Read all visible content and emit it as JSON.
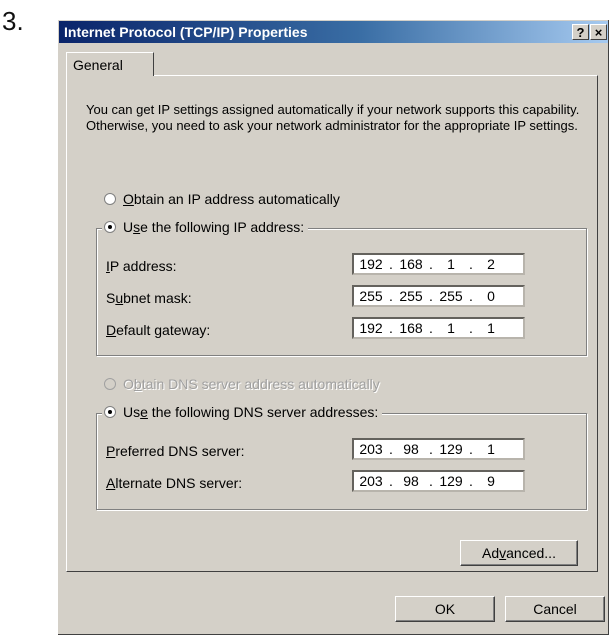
{
  "step_number": "3.",
  "window": {
    "title": "Internet Protocol (TCP/IP) Properties",
    "help_button": "?",
    "close_button": "×"
  },
  "tabs": [
    {
      "label": "General"
    }
  ],
  "intro_text": "You can get IP settings assigned automatically if your network supports this capability. Otherwise, you need to ask your network administrator for the appropriate IP settings.",
  "ip_section": {
    "auto_option": {
      "label": "Obtain an IP address automatically",
      "checked": false
    },
    "manual_option": {
      "label": "Use the following IP address:",
      "checked": true
    },
    "fields": [
      {
        "label": "IP address:",
        "octets": [
          "192",
          "168",
          "1",
          "2"
        ]
      },
      {
        "label": "Subnet mask:",
        "octets": [
          "255",
          "255",
          "255",
          "0"
        ]
      },
      {
        "label": "Default gateway:",
        "octets": [
          "192",
          "168",
          "1",
          "1"
        ]
      }
    ]
  },
  "dns_section": {
    "auto_option": {
      "label": "Obtain DNS server address automatically",
      "checked": false,
      "disabled": true
    },
    "manual_option": {
      "label": "Use the following DNS server addresses:",
      "checked": true
    },
    "fields": [
      {
        "label": "Preferred DNS server:",
        "octets": [
          "203",
          "98",
          "129",
          "1"
        ]
      },
      {
        "label": "Alternate DNS server:",
        "octets": [
          "203",
          "98",
          "129",
          "9"
        ]
      }
    ]
  },
  "buttons": {
    "advanced": "Advanced...",
    "ok": "OK",
    "cancel": "Cancel"
  }
}
